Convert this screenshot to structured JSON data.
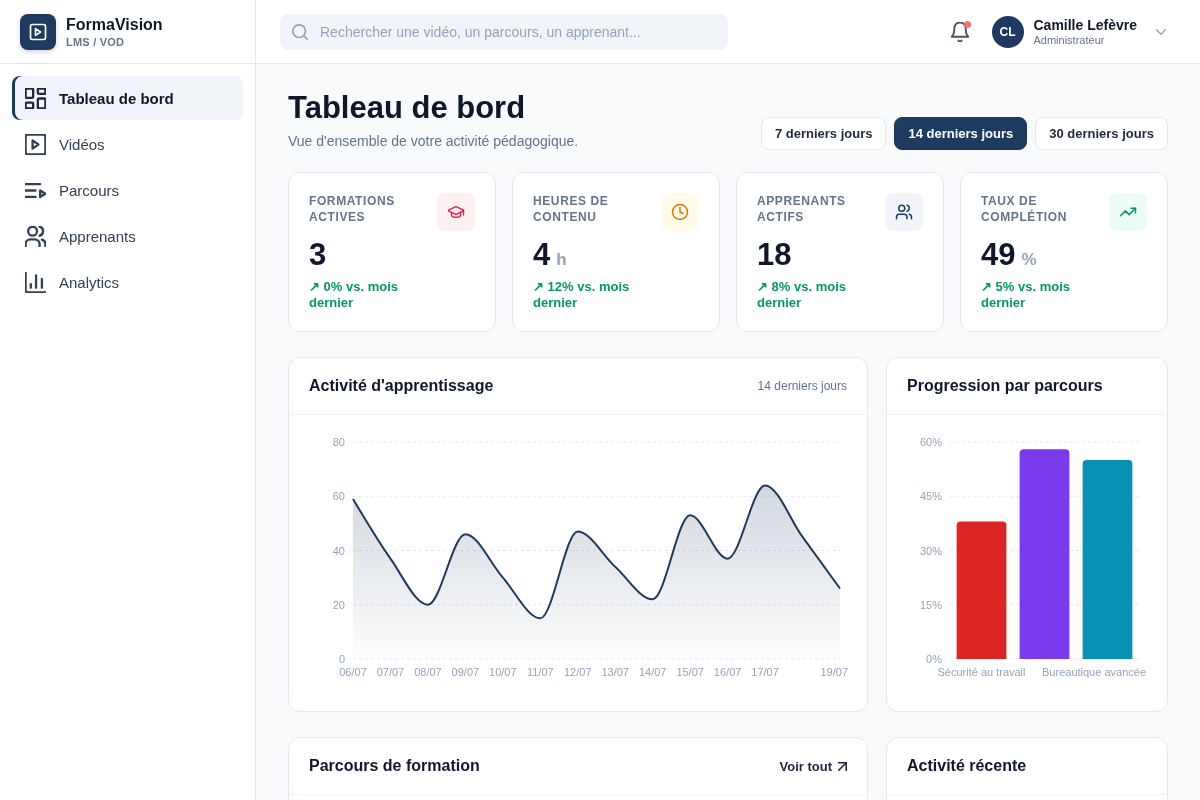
{
  "sidebar": {
    "brand": {
      "name": "FormaVision",
      "tagline": "LMS / VOD"
    },
    "items": [
      {
        "label": "Tableau de bord",
        "kind": "dashboard",
        "selected": true
      },
      {
        "label": "Vidéos",
        "kind": "videos",
        "selected": false
      },
      {
        "label": "Parcours",
        "kind": "paths",
        "selected": false
      },
      {
        "label": "Apprenants",
        "kind": "learners",
        "selected": false
      },
      {
        "label": "Analytics",
        "kind": "analytics",
        "selected": false
      }
    ]
  },
  "topbar": {
    "search": {
      "placeholder": "Rechercher une vidéo, un parcours, un apprenant..."
    },
    "notifications": {
      "unread": true
    },
    "user": {
      "initials": "CL",
      "name": "Camille Lefèvre",
      "role": "Administrateur"
    }
  },
  "header": {
    "title": "Tableau de bord",
    "subtitle": "Vue d'ensemble de votre activité pédagogique.",
    "ranges": [
      {
        "label": "7 derniers jours",
        "selected": false
      },
      {
        "label": "14 derniers jours",
        "selected": true
      },
      {
        "label": "30 derniers jours",
        "selected": false
      }
    ]
  },
  "stats": [
    {
      "kind": "courses",
      "title": "FORMATIONS ACTIVES",
      "value": "3",
      "change": "↗ 0% vs. mois dernier"
    },
    {
      "kind": "hours",
      "title": "HEURES DE CONTENU",
      "value": "4",
      "unit": "h",
      "change": "↗ 12% vs. mois dernier"
    },
    {
      "kind": "learners",
      "title": "APPRENANTS ACTIFS",
      "value": "18",
      "change": "↗ 8% vs. mois dernier"
    },
    {
      "kind": "completion",
      "title": "TAUX DE COMPLÉTION",
      "value": "49",
      "unit": "%",
      "change": "↗ 5% vs. mois dernier"
    }
  ],
  "activity_chart": {
    "title": "Activité d'apprentissage",
    "period": "14 derniers jours",
    "chart_data": {
      "type": "area",
      "categories": [
        "06/07",
        "07/07",
        "08/07",
        "09/07",
        "10/07",
        "11/07",
        "12/07",
        "13/07",
        "14/07",
        "15/07",
        "16/07",
        "17/07",
        null,
        "19/07"
      ],
      "values": [
        59,
        37,
        20,
        46,
        30,
        15,
        47,
        34,
        22,
        53,
        37,
        64,
        45,
        26
      ],
      "ylim": [
        0,
        80
      ],
      "yticks": [
        0,
        20,
        40,
        60,
        80
      ],
      "grid": true
    }
  },
  "progress_chart": {
    "title": "Progression par parcours",
    "chart_data": {
      "type": "bar",
      "categories": [
        "Sécurité au travail",
        null,
        "Bureautique avancée"
      ],
      "values": [
        38,
        58,
        55
      ],
      "colors": [
        "#dc2626",
        "#7c3aed",
        "#0891b2"
      ],
      "ylim": [
        0,
        60
      ],
      "yticks": [
        {
          "value": 0,
          "label": "0%"
        },
        {
          "value": 15,
          "label": "15%"
        },
        {
          "value": 30,
          "label": "30%"
        },
        {
          "value": 45,
          "label": "45%"
        },
        {
          "value": 60,
          "label": "60%"
        }
      ],
      "grid": true
    }
  },
  "courses_panel": {
    "title": "Parcours de formation",
    "link": "Voir tout"
  },
  "recent_panel": {
    "title": "Activité récente"
  }
}
